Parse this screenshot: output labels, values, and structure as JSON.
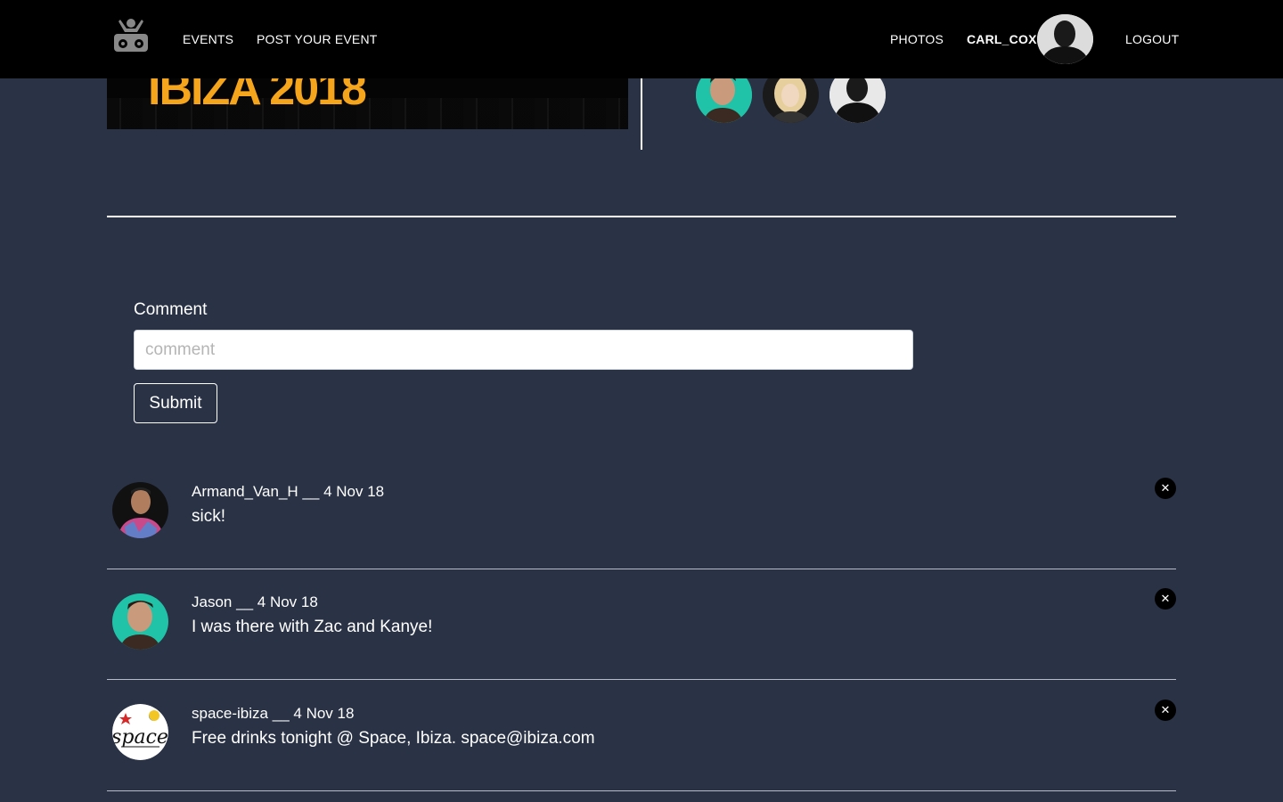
{
  "nav": {
    "events": "EVENTS",
    "post_event": "POST YOUR EVENT",
    "photos": "PHOTOS",
    "username": "CARL_COX",
    "logout": "LOGOUT"
  },
  "hero": {
    "title_fragment": "IBIZA 2018"
  },
  "form": {
    "label": "Comment",
    "placeholder": "comment",
    "value": "",
    "submit": "Submit"
  },
  "comments": [
    {
      "author": "Armand_Van_H",
      "separator": "__",
      "date": "4 Nov 18",
      "text": "sick!",
      "avatar_icon": "user-avatar-icon"
    },
    {
      "author": "Jason",
      "separator": "__",
      "date": "4 Nov 18",
      "text": "I was there with Zac and Kanye!",
      "avatar_icon": "user-avatar-icon"
    },
    {
      "author": "space-ibiza",
      "separator": "__",
      "date": "4 Nov 18",
      "text": "Free drinks tonight @ Space, Ibiza. space@ibiza.com",
      "avatar_icon": "space-logo-icon"
    }
  ],
  "colors": {
    "background": "#2a3245",
    "navbar": "#000000",
    "accent": "#f5a51c",
    "attendee_teal": "#20c2a8"
  }
}
